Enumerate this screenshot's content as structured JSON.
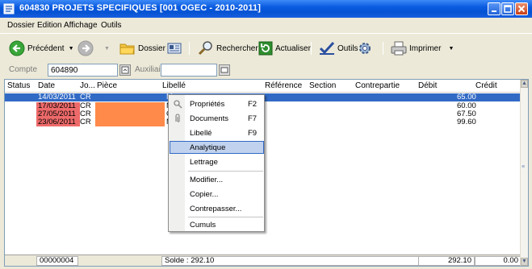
{
  "window": {
    "title": "604830  PROJETS SPECIFIQUES [001 OGEC - 2010-2011]",
    "icon": "journal-icon",
    "controls": [
      "minimize",
      "maximize",
      "close"
    ]
  },
  "menu": [
    "Dossier",
    "Edition",
    "Affichage",
    "Outils"
  ],
  "toolbar": {
    "previous": "Précédent",
    "dossier": "Dossier",
    "rechercher": "Rechercher",
    "actualiser": "Actualiser",
    "outils": "Outils",
    "imprimer": "Imprimer"
  },
  "filters": {
    "compte_label": "Compte",
    "compte_value": "604890",
    "auxiliaire_label": "Auxiliaire",
    "auxiliaire_value": ""
  },
  "grid": {
    "columns": [
      "Status",
      "Date",
      "Jo...",
      "Pièce",
      "Libellé",
      "Référence",
      "Section",
      "Contrepartie",
      "Débit",
      "Crédit"
    ],
    "rows": [
      {
        "date": "14/03/2011",
        "journal": "CR",
        "libelle": "M",
        "debit": "65.00",
        "selected": true,
        "highlight": false
      },
      {
        "date": "17/03/2011",
        "journal": "CR",
        "libelle": "M",
        "debit": "60.00",
        "selected": false,
        "highlight": true
      },
      {
        "date": "27/05/2011",
        "journal": "CR",
        "libelle": "Cl",
        "debit": "67.50",
        "selected": false,
        "highlight": true
      },
      {
        "date": "23/06/2011",
        "journal": "CR",
        "libelle": "M",
        "debit": "99.60",
        "selected": false,
        "highlight": true
      }
    ],
    "footer": {
      "count": "00000004",
      "solde": "Solde : 292.10",
      "total_debit": "292.10",
      "total_credit": "0.00"
    }
  },
  "context_menu": {
    "items": [
      {
        "label": "Propriétés",
        "shortcut": "F2"
      },
      {
        "label": "Documents",
        "shortcut": "F7"
      },
      {
        "label": "Libellé",
        "shortcut": "F9"
      },
      {
        "label": "Analytique",
        "shortcut": ""
      },
      {
        "label": "Lettrage",
        "shortcut": ""
      },
      {
        "label": "Modifier...",
        "shortcut": ""
      },
      {
        "label": "Copier...",
        "shortcut": ""
      },
      {
        "label": "Contrepasser...",
        "shortcut": ""
      },
      {
        "label": "Cumuls",
        "shortcut": ""
      }
    ]
  },
  "colors": {
    "selection": "#316ac5",
    "date_highlight": "#ee6a6a",
    "piece_highlight": "#ff8a4a",
    "titlebar": "#0a5be0"
  }
}
